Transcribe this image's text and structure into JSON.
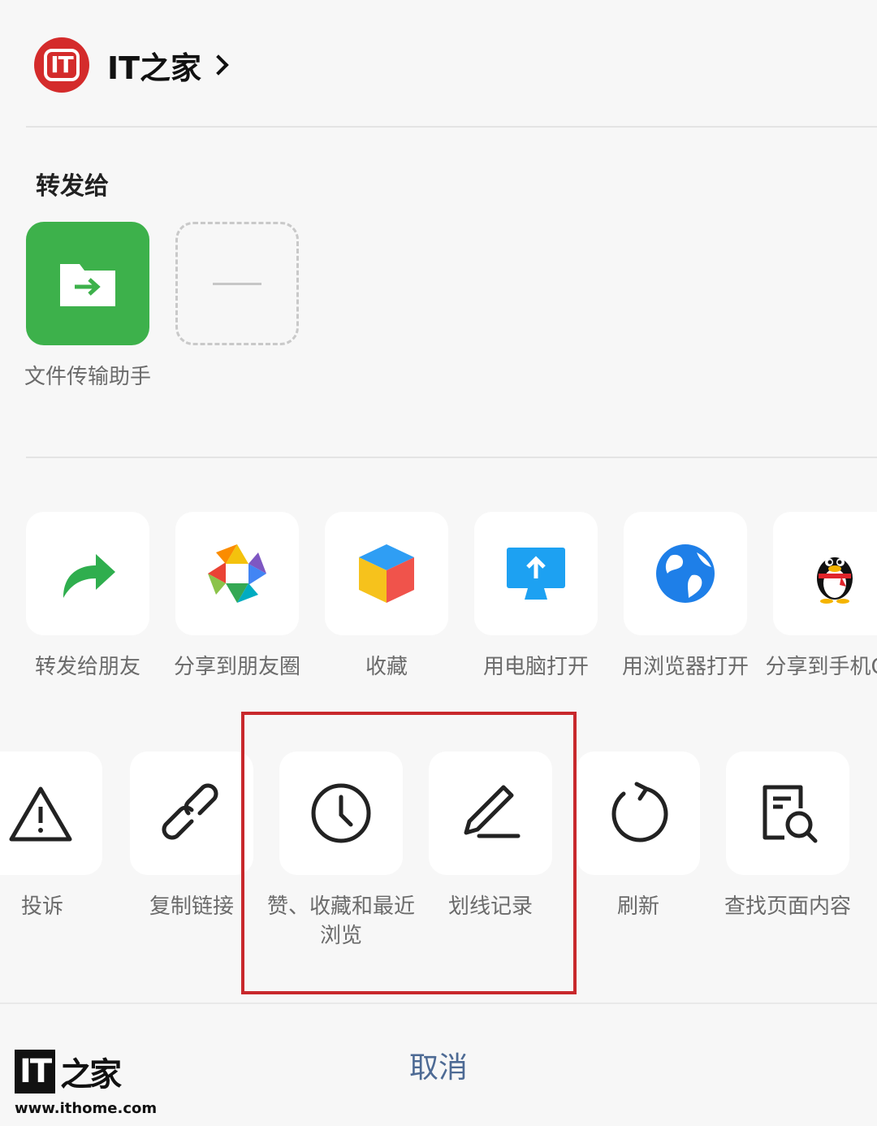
{
  "header": {
    "title": "IT之家",
    "logo_text": "IT"
  },
  "forward_section": {
    "title": "转发给",
    "contacts": [
      {
        "label": "文件传输助手",
        "icon": "folder-transfer-icon"
      },
      {
        "label": "",
        "icon": "dash-placeholder"
      }
    ]
  },
  "share_row": [
    {
      "label": "转发给朋友",
      "icon": "forward-arrow-icon"
    },
    {
      "label": "分享到朋友圈",
      "icon": "moments-aperture-icon"
    },
    {
      "label": "收藏",
      "icon": "cube-icon"
    },
    {
      "label": "用电脑打开",
      "icon": "monitor-upload-icon"
    },
    {
      "label": "用浏览器打开",
      "icon": "globe-icon"
    },
    {
      "label": "分享到手机QQ",
      "icon": "qq-penguin-icon"
    }
  ],
  "action_row": [
    {
      "label": "投诉",
      "icon": "warning-icon"
    },
    {
      "label": "复制链接",
      "icon": "link-icon"
    },
    {
      "label": "赞、收藏和最近浏览",
      "icon": "clock-icon"
    },
    {
      "label": "划线记录",
      "icon": "pen-underline-icon"
    },
    {
      "label": "刷新",
      "icon": "refresh-icon"
    },
    {
      "label": "查找页面内容",
      "icon": "find-document-icon"
    }
  ],
  "cancel_label": "取消",
  "watermark": {
    "brand": "IT",
    "url": "www.ithome.com"
  },
  "colors": {
    "accent_green": "#3db14b",
    "highlight_red": "#c8282c",
    "cancel_blue": "#4d6a94",
    "logo_red": "#d42b2b"
  }
}
